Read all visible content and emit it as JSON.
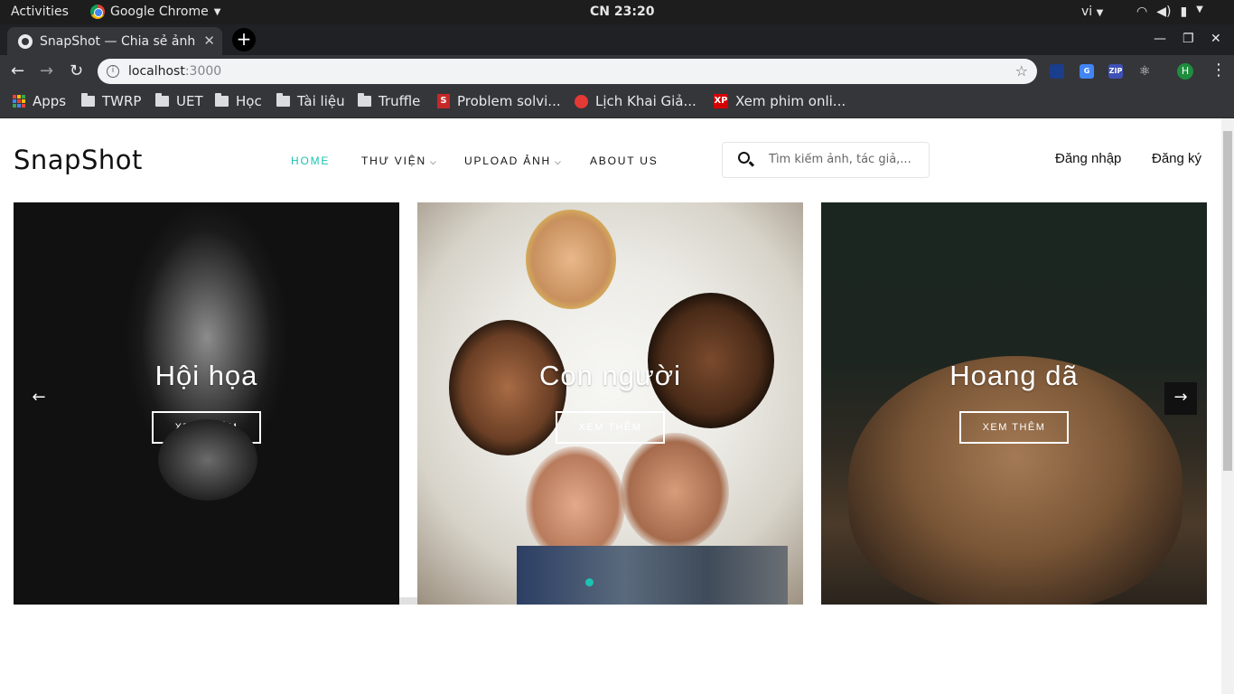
{
  "system_bar": {
    "activities": "Activities",
    "app_name": "Google Chrome",
    "clock": "CN 23:20",
    "language": "vi"
  },
  "browser": {
    "tab_title": "SnapShot — Chia sẻ ảnh trực tuyến",
    "url_host": "localhost",
    "url_port": ":3000",
    "profile_initial": "H",
    "bookmarks": [
      "Apps",
      "TWRP",
      "UET",
      "Học",
      "Tài liệu",
      "Truffle",
      "Problem solvi...",
      "Lịch Khai Giả...",
      "Xem phim onli..."
    ]
  },
  "site": {
    "logo": "SnapShot",
    "nav": {
      "home": "HOME",
      "library": "THƯ VIỆN",
      "upload": "UPLOAD ẢNH",
      "about": "ABOUT US"
    },
    "search_placeholder": "Tìm kiếm ảnh, tác giả,...",
    "login": "Đăng nhập",
    "register": "Đăng ký",
    "accent_color": "#1cc3b2"
  },
  "slides": [
    {
      "title": "Hội họa",
      "button": "XEM THÊM"
    },
    {
      "title": "Con người",
      "button": "XEM THÊM"
    },
    {
      "title": "Hoang dã",
      "button": "XEM THÊM"
    }
  ]
}
